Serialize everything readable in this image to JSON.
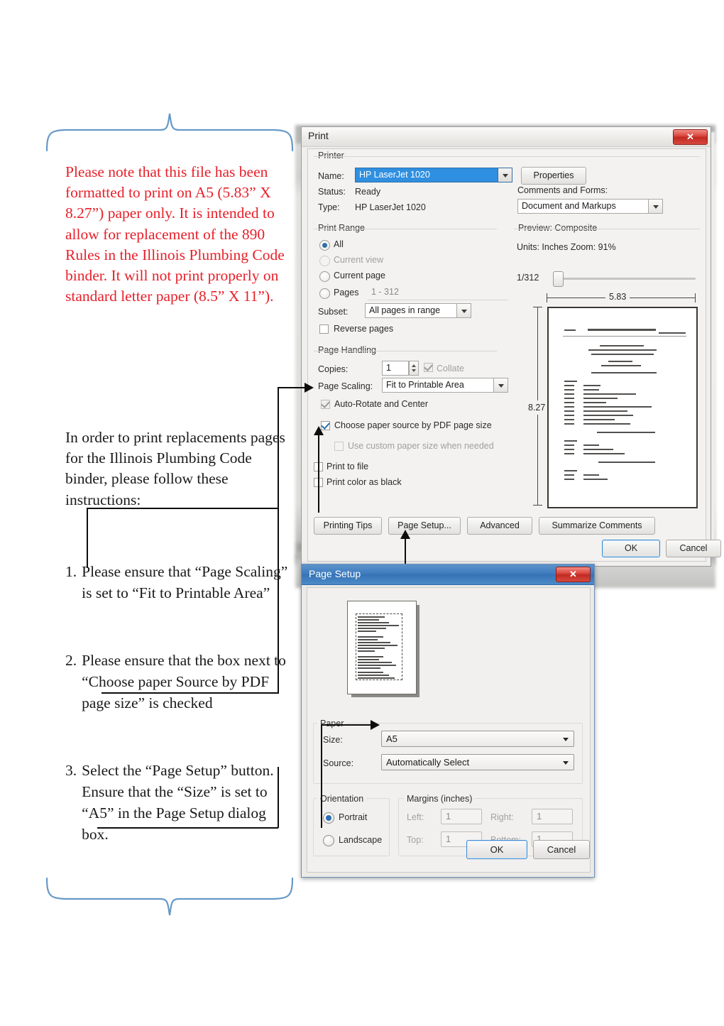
{
  "annotation": {
    "warning_text": "Please note that this file has been formatted to print on A5 (5.83” X 8.27”) paper only.  It is intended to allow for replacement of the 890 Rules in the Illinois Plumbing Code binder.  It will not print properly on standard letter paper (8.5” X 11”).",
    "warning_color": "#e8202a",
    "intro_text": "In order to print replacements pages for the Illinois Plumbing Code binder, please follow these instructions:",
    "steps": [
      {
        "number": "1.",
        "text": "Please ensure that “Page Scaling” is set to “Fit to Printable Area”"
      },
      {
        "number": "2.",
        "text": "Please ensure that the box next to “Choose paper Source by PDF page size” is checked"
      },
      {
        "number": "3.",
        "text": "Select the “Page Setup” button.  Ensure that the “Size” is set to “A5” in the Page Setup dialog box."
      }
    ],
    "brace_color": "#6699c8"
  },
  "print_dialog": {
    "title": "Print",
    "close_label": "✕",
    "printer": {
      "group_label": "Printer",
      "name_label": "Name:",
      "name_value": "HP LaserJet 1020",
      "properties_button": "Properties",
      "status_label": "Status:",
      "status_value": "Ready",
      "type_label": "Type:",
      "type_value": "HP LaserJet 1020",
      "comments_label": "Comments and Forms:",
      "comments_value": "Document and Markups"
    },
    "print_range": {
      "group_label": "Print Range",
      "options": [
        {
          "label": "All",
          "selected": true,
          "disabled": false
        },
        {
          "label": "Current view",
          "selected": false,
          "disabled": true
        },
        {
          "label": "Current page",
          "selected": false,
          "disabled": false
        },
        {
          "label": "Pages",
          "selected": false,
          "disabled": false
        }
      ],
      "pages_value": "1 - 312",
      "subset_label": "Subset:",
      "subset_value": "All pages in range",
      "reverse_label": "Reverse pages",
      "reverse_checked": false
    },
    "page_handling": {
      "group_label": "Page Handling",
      "copies_label": "Copies:",
      "copies_value": "1",
      "collate_label": "Collate",
      "collate_checked": true,
      "page_scaling_label": "Page Scaling:",
      "page_scaling_value": "Fit to Printable Area",
      "auto_rotate_label": "Auto-Rotate and Center",
      "auto_rotate_checked": true,
      "choose_source_label": "Choose paper source by PDF page size",
      "choose_source_checked": true,
      "custom_size_label": "Use custom paper size when needed",
      "custom_size_checked": false,
      "print_to_file_label": "Print to file",
      "print_to_file_checked": false,
      "print_color_black_label": "Print color as black",
      "print_color_black_checked": false
    },
    "preview": {
      "title": "Preview: Composite",
      "units_zoom": "Units: Inches Zoom:  91%",
      "page_counter": "1/312",
      "width_dimension": "5.83",
      "height_dimension": "8.27"
    },
    "buttons": {
      "printing_tips": "Printing Tips",
      "page_setup": "Page Setup...",
      "advanced": "Advanced",
      "summarize_comments": "Summarize Comments",
      "ok": "OK",
      "cancel": "Cancel"
    }
  },
  "page_setup_dialog": {
    "title": "Page Setup",
    "close_label": "✕",
    "paper": {
      "group_label": "Paper",
      "size_label": "Size:",
      "size_value": "A5",
      "source_label": "Source:",
      "source_value": "Automatically Select"
    },
    "orientation": {
      "group_label": "Orientation",
      "options": [
        {
          "label": "Portrait",
          "selected": true
        },
        {
          "label": "Landscape",
          "selected": false
        }
      ]
    },
    "margins": {
      "group_label": "Margins (inches)",
      "left_label": "Left:",
      "left_value": "1",
      "right_label": "Right:",
      "right_value": "1",
      "top_label": "Top:",
      "top_value": "1",
      "bottom_label": "Bottom:",
      "bottom_value": "1"
    },
    "buttons": {
      "ok": "OK",
      "cancel": "Cancel"
    }
  }
}
